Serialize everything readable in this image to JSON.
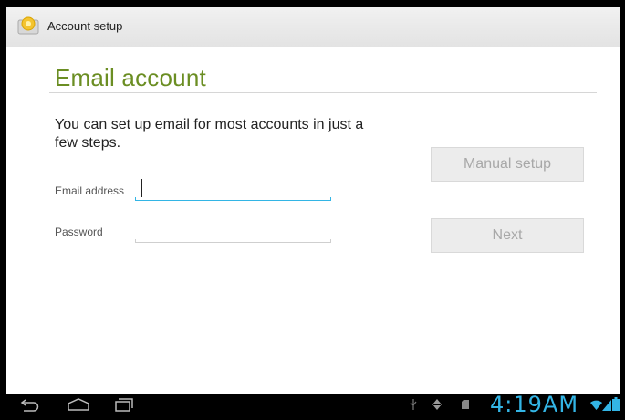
{
  "action_bar": {
    "title": "Account setup",
    "icon": "email-app-icon"
  },
  "screen": {
    "title": "Email account",
    "intro": "You can set up email for most accounts in just a few steps."
  },
  "form": {
    "email_label": "Email address",
    "email_value": "",
    "password_label": "Password",
    "password_value": ""
  },
  "buttons": {
    "manual_setup": "Manual setup",
    "next": "Next"
  },
  "system_bar": {
    "clock": "4:19AM",
    "icons": [
      "back-icon",
      "home-icon",
      "recent-apps-icon",
      "usb-icon",
      "usb-debug-icon",
      "sd-card-icon",
      "wifi-icon",
      "signal-icon",
      "battery-icon"
    ]
  },
  "colors": {
    "title_green": "#6b8e23",
    "holo_blue": "#33b5e5",
    "button_disabled_text": "#a8a8a8"
  }
}
